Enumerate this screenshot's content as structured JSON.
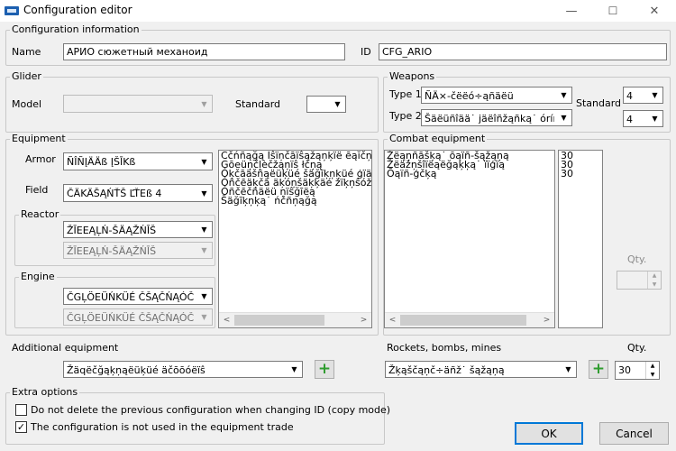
{
  "window": {
    "title": "Configuration editor",
    "minimize": "—",
    "maximize": "☐",
    "close": "✕"
  },
  "config_info": {
    "group_label": "Configuration information",
    "name_label": "Name",
    "name_value": "АРИО сюжетный механоид",
    "id_label": "ID",
    "id_value": "CFG_ARIO"
  },
  "glider": {
    "group_label": "Glider",
    "model_label": "Model",
    "model_value": "",
    "standard_label": "Standard",
    "standard_value": ""
  },
  "weapons": {
    "group_label": "Weapons",
    "type1_label": "Type 1",
    "type1_value": "ÑÄ×-čëëó÷ąñäëü",
    "type2_label": "Type 2",
    "type2_value": "Šäëüñîää˙ jäëîñžąñką˙ óríñąk",
    "standard_label": "Standard",
    "standard1_value": "4",
    "standard2_value": "4"
  },
  "equipment": {
    "group_label": "Equipment",
    "armor_label": "Armor",
    "armor_value": "ÑÎÑĮÄÄß ĮŠĪKß",
    "field_label": "Field",
    "field_value": "ČÄKÄŠĄŃŤŠ ĽŤEß 4",
    "reactor_label": "Reactor",
    "reactor_value": "ŽĪEEĄĻŃ-ŠÄĄŽŃĪŠ",
    "reactor_value2": "ŽĪEEĄĻŃ-ŠÄĄŽŃĪŠ",
    "engine_label": "Engine",
    "engine_value": "ČGĻÖEÜŃKÜÉ ČŠĄČŃĄÓČ",
    "engine_value2": "ČGĻÖEÜŃKÜÉ ČŠĄČŃĄÓČ",
    "list": [
      "Cčńñąğą Ĭŝïņčāïŝąžąņķïë ēąĭčņü",
      "Gōeüņčļèčžąņïŝ łčņą",
      "Óķčāäšñąëüķüé šäğīķņķüé ģïäóéü",
      "Óñčēäķčā äķóņšäķķäé žïķņŝóžóč",
      "Óñčēčñäëü ņïŝğīëą",
      "Šäğīķņķą˙ ńčñņąğą"
    ],
    "additional_label": "Additional equipment",
    "additional_value": "Žäqëčğąķņąëüķüé äčōōóëïŝ"
  },
  "combat": {
    "group_label": "Combat equipment",
    "items": [
      "Žëąņñāšķą˙ ōąïñ-šąžąņą",
      "Žëäžņšîïëąëğąķķą˙ ïïģïą",
      "Ōąïñ-ģčķą"
    ],
    "qtys": [
      "30",
      "30",
      "30"
    ],
    "qty_label": "Qty.",
    "qty_value": "",
    "rockets_label": "Rockets, bombs, mines",
    "rockets_value": "Žķąščąņč÷äñž˙ šąžąņą",
    "rockets_qty_label": "Qty.",
    "rockets_qty_value": "30"
  },
  "extra": {
    "group_label": "Extra options",
    "opt1_label": "Do not delete the previous configuration when changing ID (copy mode)",
    "opt1_checked": "",
    "opt2_label": "The configuration is not used in the equipment trade",
    "opt2_checked": "✓"
  },
  "buttons": {
    "ok": "OK",
    "cancel": "Cancel",
    "add": "+"
  },
  "icons": {
    "dropdown": "▼",
    "up": "▲",
    "down": "▼",
    "left": "<",
    "right": ">"
  },
  "colors": {
    "accent": "#0078d7",
    "plus": "#2e9c2e"
  }
}
